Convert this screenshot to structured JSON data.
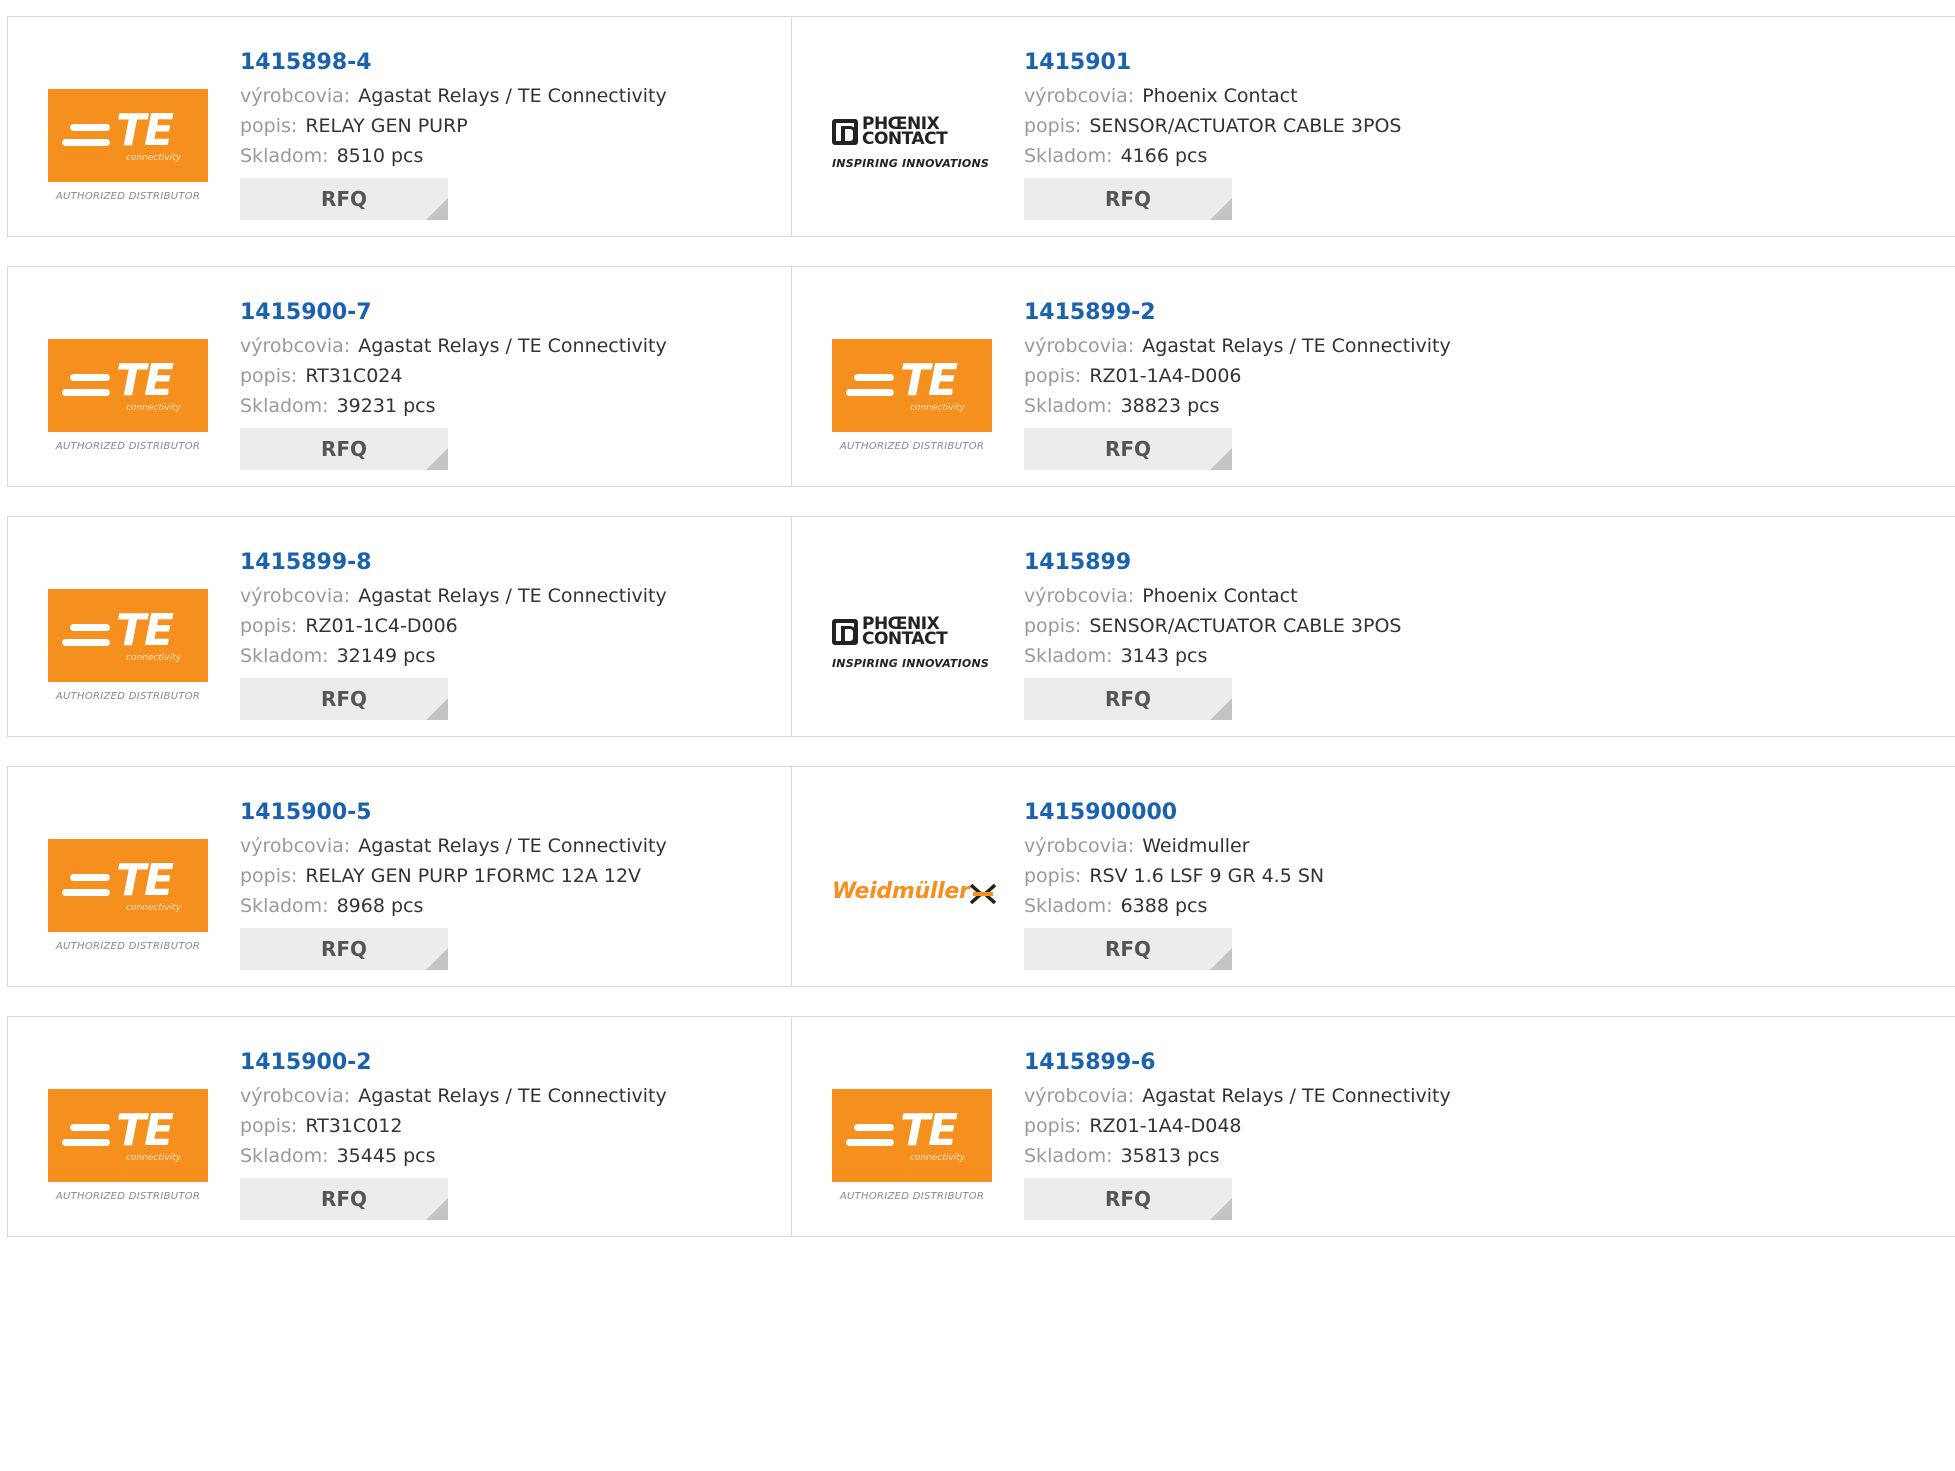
{
  "labels": {
    "manufacturer": "výrobcovia:",
    "description": "popis:",
    "stock": "Skladom:",
    "rfq": "RFQ"
  },
  "brand_logos": {
    "te": {
      "name": "TE",
      "sub": "connectivity",
      "tag": "AUTHORIZED DISTRIBUTOR",
      "color": "#f5901f"
    },
    "phoenix": {
      "line1": "PHŒNIX",
      "line2": "CONTACT",
      "tag": "INSPIRING INNOVATIONS"
    },
    "weidmuller": {
      "name": "Weidmüller",
      "color": "#f5901f"
    }
  },
  "products": [
    {
      "part": "1415898-4",
      "logo": "te",
      "manufacturer": "Agastat Relays / TE Connectivity",
      "description": "RELAY GEN PURP",
      "stock": "8510 pcs"
    },
    {
      "part": "1415901",
      "logo": "phoenix",
      "manufacturer": "Phoenix Contact",
      "description": "SENSOR/ACTUATOR CABLE 3POS",
      "stock": "4166 pcs"
    },
    {
      "part": "1415900-7",
      "logo": "te",
      "manufacturer": "Agastat Relays / TE Connectivity",
      "description": "RT31C024",
      "stock": "39231 pcs"
    },
    {
      "part": "1415899-2",
      "logo": "te",
      "manufacturer": "Agastat Relays / TE Connectivity",
      "description": "RZ01-1A4-D006",
      "stock": "38823 pcs"
    },
    {
      "part": "1415899-8",
      "logo": "te",
      "manufacturer": "Agastat Relays / TE Connectivity",
      "description": "RZ01-1C4-D006",
      "stock": "32149 pcs"
    },
    {
      "part": "1415899",
      "logo": "phoenix",
      "manufacturer": "Phoenix Contact",
      "description": "SENSOR/ACTUATOR CABLE 3POS",
      "stock": "3143 pcs"
    },
    {
      "part": "1415900-5",
      "logo": "te",
      "manufacturer": "Agastat Relays / TE Connectivity",
      "description": "RELAY GEN PURP 1FORMC 12A 12V",
      "stock": "8968 pcs"
    },
    {
      "part": "1415900000",
      "logo": "weidmuller",
      "manufacturer": "Weidmuller",
      "description": "RSV 1.6 LSF 9 GR 4.5 SN",
      "stock": "6388 pcs"
    },
    {
      "part": "1415900-2",
      "logo": "te",
      "manufacturer": "Agastat Relays / TE Connectivity",
      "description": "RT31C012",
      "stock": "35445 pcs"
    },
    {
      "part": "1415899-6",
      "logo": "te",
      "manufacturer": "Agastat Relays / TE Connectivity",
      "description": "RZ01-1A4-D048",
      "stock": "35813 pcs"
    }
  ]
}
